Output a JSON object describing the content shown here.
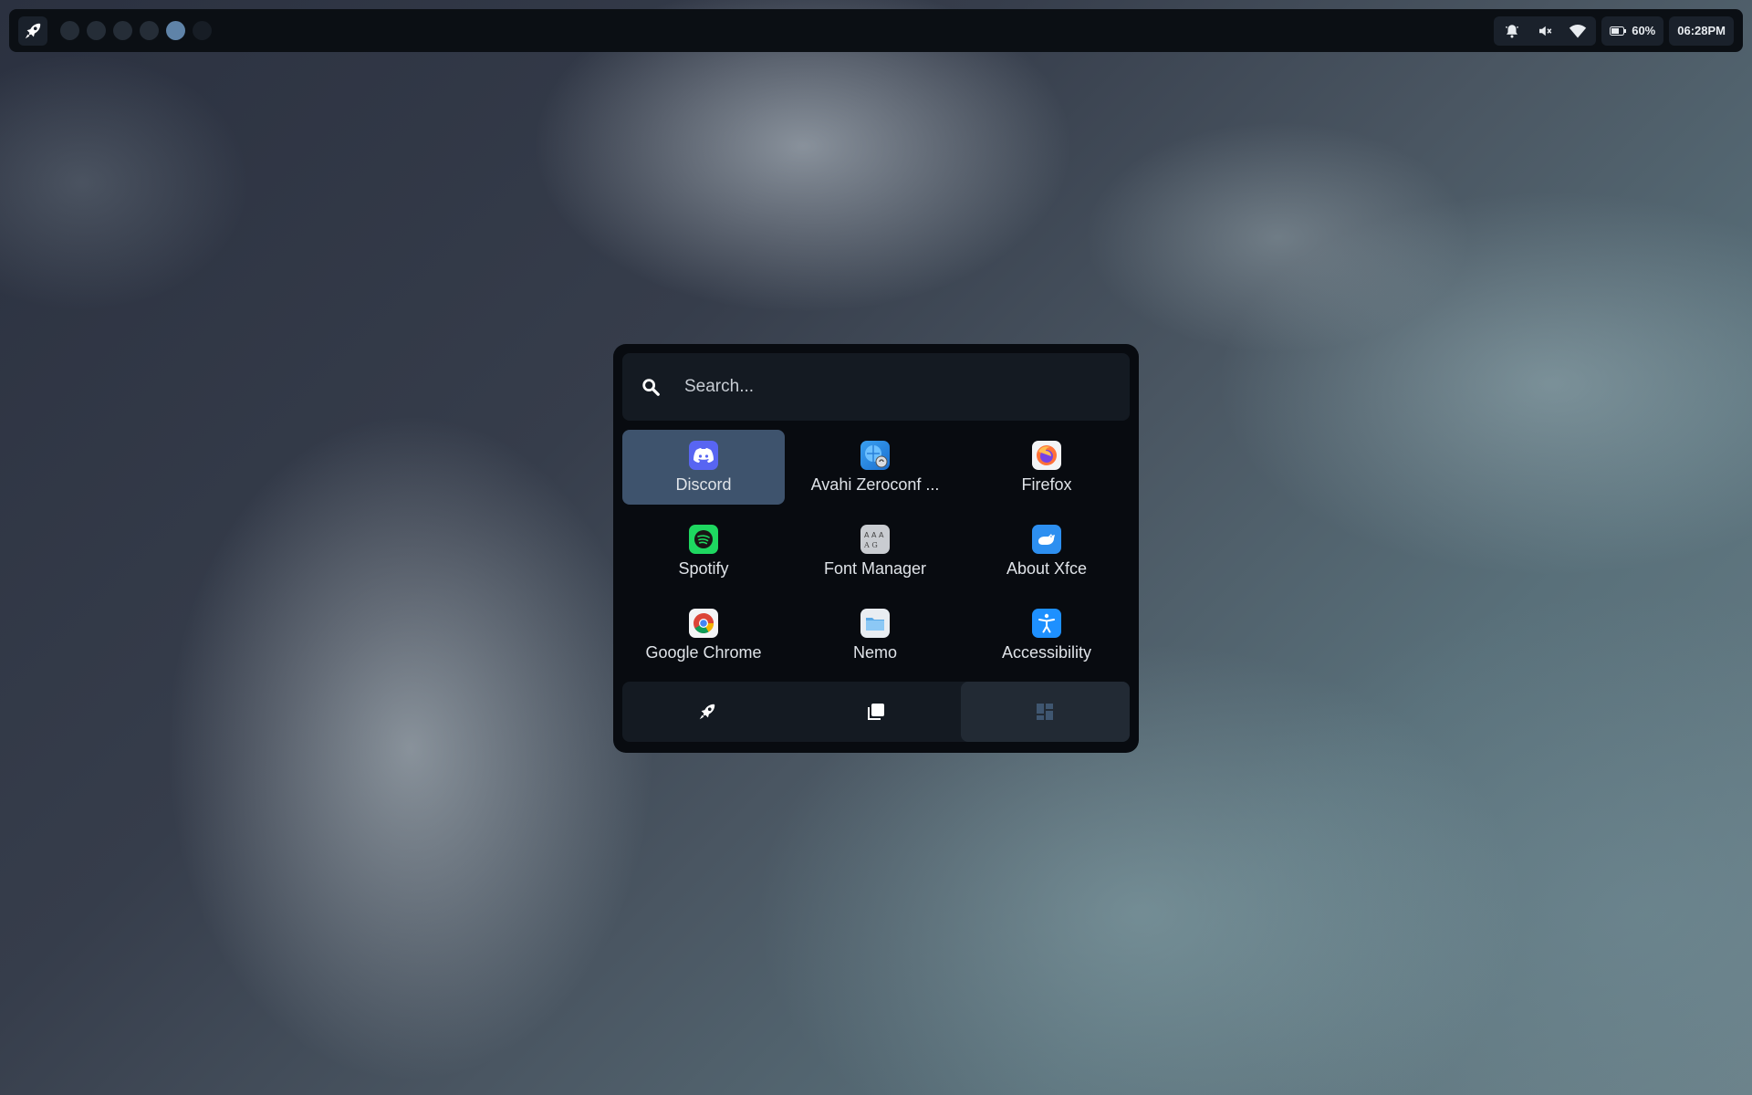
{
  "topbar": {
    "workspaces": [
      {
        "state": "normal"
      },
      {
        "state": "normal"
      },
      {
        "state": "normal"
      },
      {
        "state": "normal"
      },
      {
        "state": "active"
      },
      {
        "state": "dim"
      }
    ],
    "battery_label": "60%",
    "clock": "06:28PM",
    "icons": [
      "rocket-icon",
      "bell-icon",
      "volume-muted-icon",
      "wifi-icon",
      "battery-icon"
    ]
  },
  "launcher": {
    "search_placeholder": "Search...",
    "apps": [
      {
        "label": "Discord",
        "icon": "discord-icon",
        "selected": true
      },
      {
        "label": "Avahi Zeroconf ...",
        "icon": "avahi-icon"
      },
      {
        "label": "Firefox",
        "icon": "firefox-icon"
      },
      {
        "label": "Spotify",
        "icon": "spotify-icon"
      },
      {
        "label": "Font Manager",
        "icon": "font-manager-icon"
      },
      {
        "label": "About Xfce",
        "icon": "xfce-icon"
      },
      {
        "label": "Google Chrome",
        "icon": "chrome-icon"
      },
      {
        "label": "Nemo",
        "icon": "folder-icon"
      },
      {
        "label": "Accessibility",
        "icon": "accessibility-icon"
      }
    ],
    "tabs": [
      {
        "icon": "rocket-icon"
      },
      {
        "icon": "windows-icon"
      },
      {
        "icon": "dashboard-icon",
        "active": true
      }
    ]
  },
  "colors": {
    "accent": "#5f83a8",
    "selected_app": "#3e536d",
    "panel_bg": "#080b10"
  }
}
